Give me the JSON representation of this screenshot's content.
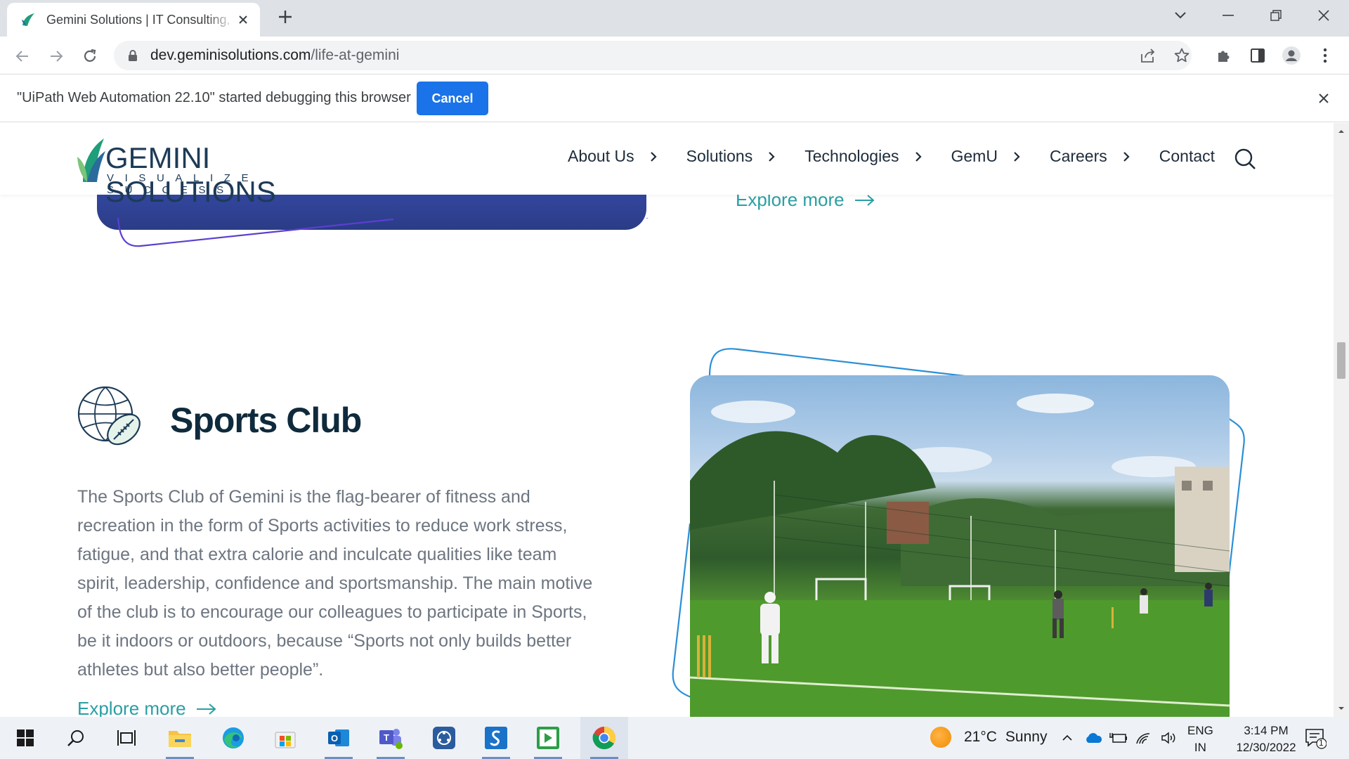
{
  "browser": {
    "tab_title": "Gemini Solutions | IT Consulting, Software Development",
    "url_host": "dev.geminisolutions.com",
    "url_path": "/life-at-gemini"
  },
  "infobar": {
    "message": "\"UiPath Web Automation 22.10\" started debugging this browser",
    "cancel_label": "Cancel"
  },
  "site": {
    "logo_word1": "GEMINI",
    "logo_word2": "SOLUTIONS",
    "logo_tagline": "VISUALIZE SUCCESS",
    "nav": [
      {
        "label": "About Us"
      },
      {
        "label": "Solutions"
      },
      {
        "label": "Technologies"
      },
      {
        "label": "GemU"
      },
      {
        "label": "Careers"
      },
      {
        "label": "Contact"
      }
    ]
  },
  "content": {
    "explore_top": "Explore more",
    "sports_title": "Sports Club",
    "sports_text": "The Sports Club of Gemini is the flag-bearer of fitness and recreation in the form of Sports activities to reduce work stress, fatigue, and that extra calorie and inculcate qualities like team spirit, leadership, confidence and sportsmanship. The main motive of the club is to encourage our colleagues to participate in Sports, be it indoors or outdoors, because “Sports not only builds better athletes but also better people”.",
    "explore_bottom": "Explore more"
  },
  "taskbar": {
    "weather_temp": "21°C",
    "weather_desc": "Sunny",
    "lang_line1": "ENG",
    "lang_line2": "IN",
    "time": "3:14 PM",
    "date": "12/30/2022",
    "notification_count": "1"
  },
  "colors": {
    "accent_teal": "#2a9fa3",
    "brand_navy": "#1d3b57",
    "chrome_blue": "#1a73e8"
  }
}
